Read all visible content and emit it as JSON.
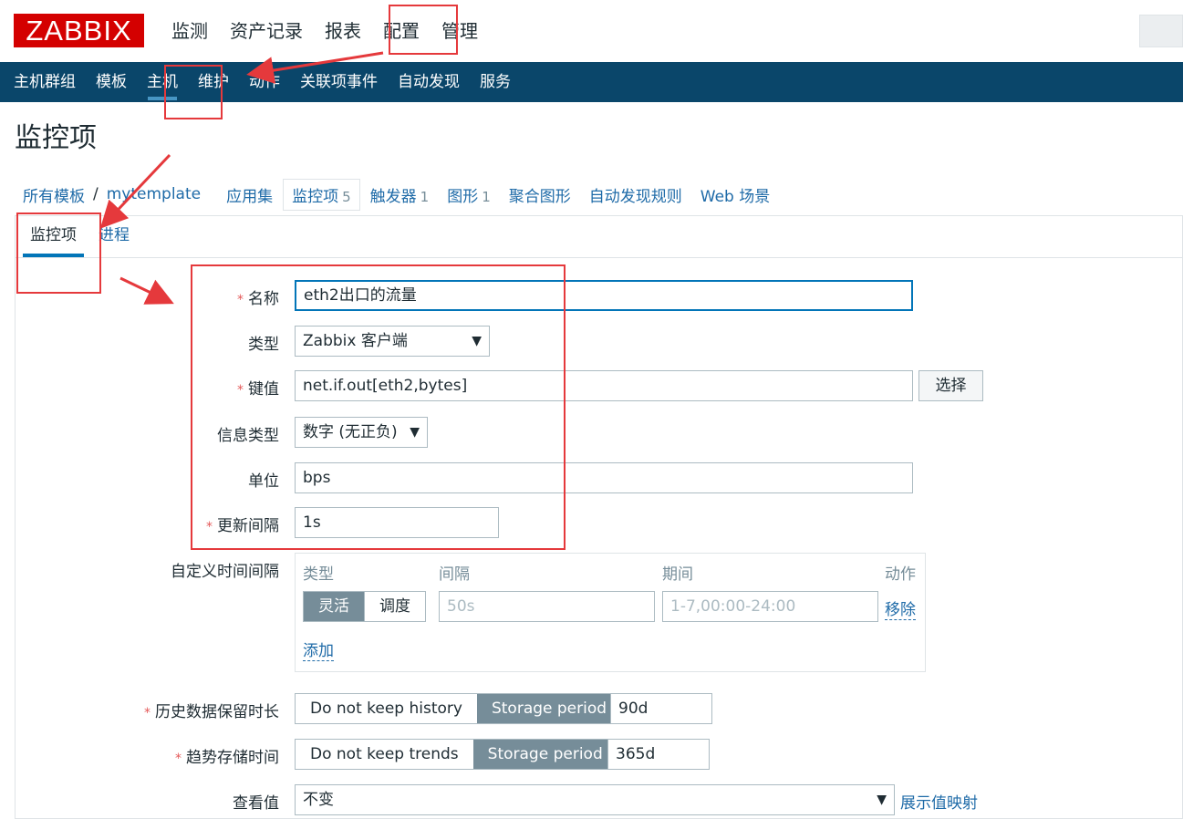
{
  "app": {
    "logo_text": "ZABBIX"
  },
  "top_menu": [
    "监测",
    "资产记录",
    "报表",
    "配置",
    "管理"
  ],
  "sub_nav": [
    "主机群组",
    "模板",
    "主机",
    "维护",
    "动作",
    "关联项事件",
    "自动发现",
    "服务"
  ],
  "page_title": "监控项",
  "breadcrumbs": {
    "all_templates": "所有模板",
    "separator": "/",
    "template": "mytemplate",
    "applications": "应用集",
    "items": {
      "label": "监控项",
      "count": "5"
    },
    "triggers": {
      "label": "触发器",
      "count": "1"
    },
    "graphs": {
      "label": "图形",
      "count": "1"
    },
    "screens": "聚合图形",
    "discovery": "自动发现规则",
    "web": "Web 场景"
  },
  "tabs": [
    "监控项",
    "进程"
  ],
  "form": {
    "name": {
      "label": "名称",
      "value": "eth2出口的流量"
    },
    "type": {
      "label": "类型",
      "value": "Zabbix 客户端"
    },
    "key": {
      "label": "键值",
      "value": "net.if.out[eth2,bytes]",
      "button": "选择"
    },
    "info_type": {
      "label": "信息类型",
      "value": "数字 (无正负)"
    },
    "units": {
      "label": "单位",
      "value": "bps"
    },
    "update_interval": {
      "label": "更新间隔",
      "value": "1s"
    },
    "custom_intervals": {
      "label": "自定义时间间隔",
      "headers": {
        "type": "类型",
        "interval": "间隔",
        "period": "期间",
        "action": "动作"
      },
      "type_options": [
        "灵活",
        "调度"
      ],
      "interval_placeholder": "50s",
      "period_placeholder": "1-7,00:00-24:00",
      "remove": "移除",
      "add": "添加"
    },
    "history": {
      "label": "历史数据保留时长",
      "options": [
        "Do not keep history",
        "Storage period"
      ],
      "value": "90d"
    },
    "trends": {
      "label": "趋势存储时间",
      "options": [
        "Do not keep trends",
        "Storage period"
      ],
      "value": "365d"
    },
    "show_value": {
      "label": "查看值",
      "value": "不变",
      "link": "展示值映射"
    }
  },
  "colors": {
    "brand_red": "#d40000",
    "nav_blue": "#0a466a",
    "link_blue": "#1f6ba8",
    "annotation_red": "#e5393c"
  }
}
